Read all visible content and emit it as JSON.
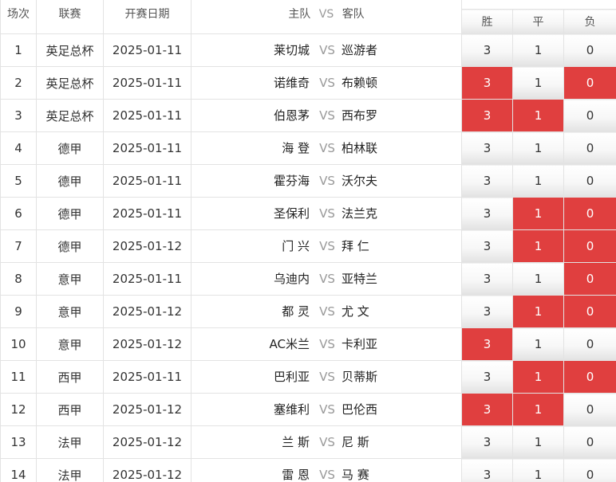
{
  "header": {
    "no": "场次",
    "league": "联赛",
    "date": "开赛日期",
    "home": "主队",
    "vs": "VS",
    "away": "客队",
    "win": "胜",
    "draw": "平",
    "lose": "负"
  },
  "accent_color": "#e03f3f",
  "rows": [
    {
      "no": "1",
      "league": "英足总杯",
      "date": "2025-01-11",
      "home": "莱切城",
      "vs": "VS",
      "away": "巡游者",
      "win": "3",
      "draw": "1",
      "lose": "0",
      "win_on": false,
      "draw_on": false,
      "lose_on": false
    },
    {
      "no": "2",
      "league": "英足总杯",
      "date": "2025-01-11",
      "home": "诺维奇",
      "vs": "VS",
      "away": "布赖顿",
      "win": "3",
      "draw": "1",
      "lose": "0",
      "win_on": true,
      "draw_on": false,
      "lose_on": true
    },
    {
      "no": "3",
      "league": "英足总杯",
      "date": "2025-01-11",
      "home": "伯恩茅",
      "vs": "VS",
      "away": "西布罗",
      "win": "3",
      "draw": "1",
      "lose": "0",
      "win_on": true,
      "draw_on": true,
      "lose_on": false
    },
    {
      "no": "4",
      "league": "德甲",
      "date": "2025-01-11",
      "home": "海 登",
      "vs": "VS",
      "away": "柏林联",
      "win": "3",
      "draw": "1",
      "lose": "0",
      "win_on": false,
      "draw_on": false,
      "lose_on": false
    },
    {
      "no": "5",
      "league": "德甲",
      "date": "2025-01-11",
      "home": "霍芬海",
      "vs": "VS",
      "away": "沃尔夫",
      "win": "3",
      "draw": "1",
      "lose": "0",
      "win_on": false,
      "draw_on": false,
      "lose_on": false
    },
    {
      "no": "6",
      "league": "德甲",
      "date": "2025-01-11",
      "home": "圣保利",
      "vs": "VS",
      "away": "法兰克",
      "win": "3",
      "draw": "1",
      "lose": "0",
      "win_on": false,
      "draw_on": true,
      "lose_on": true
    },
    {
      "no": "7",
      "league": "德甲",
      "date": "2025-01-12",
      "home": "门 兴",
      "vs": "VS",
      "away": "拜 仁",
      "win": "3",
      "draw": "1",
      "lose": "0",
      "win_on": false,
      "draw_on": true,
      "lose_on": true
    },
    {
      "no": "8",
      "league": "意甲",
      "date": "2025-01-11",
      "home": "乌迪内",
      "vs": "VS",
      "away": "亚特兰",
      "win": "3",
      "draw": "1",
      "lose": "0",
      "win_on": false,
      "draw_on": false,
      "lose_on": true
    },
    {
      "no": "9",
      "league": "意甲",
      "date": "2025-01-12",
      "home": "都 灵",
      "vs": "VS",
      "away": "尤 文",
      "win": "3",
      "draw": "1",
      "lose": "0",
      "win_on": false,
      "draw_on": true,
      "lose_on": true
    },
    {
      "no": "10",
      "league": "意甲",
      "date": "2025-01-12",
      "home": "AC米兰",
      "vs": "VS",
      "away": "卡利亚",
      "win": "3",
      "draw": "1",
      "lose": "0",
      "win_on": true,
      "draw_on": false,
      "lose_on": false
    },
    {
      "no": "11",
      "league": "西甲",
      "date": "2025-01-11",
      "home": "巴利亚",
      "vs": "VS",
      "away": "贝蒂斯",
      "win": "3",
      "draw": "1",
      "lose": "0",
      "win_on": false,
      "draw_on": true,
      "lose_on": true
    },
    {
      "no": "12",
      "league": "西甲",
      "date": "2025-01-12",
      "home": "塞维利",
      "vs": "VS",
      "away": "巴伦西",
      "win": "3",
      "draw": "1",
      "lose": "0",
      "win_on": true,
      "draw_on": true,
      "lose_on": false
    },
    {
      "no": "13",
      "league": "法甲",
      "date": "2025-01-12",
      "home": "兰 斯",
      "vs": "VS",
      "away": "尼 斯",
      "win": "3",
      "draw": "1",
      "lose": "0",
      "win_on": false,
      "draw_on": false,
      "lose_on": false
    },
    {
      "no": "14",
      "league": "法甲",
      "date": "2025-01-12",
      "home": "雷 恩",
      "vs": "VS",
      "away": "马 赛",
      "win": "3",
      "draw": "1",
      "lose": "0",
      "win_on": false,
      "draw_on": false,
      "lose_on": false
    }
  ]
}
